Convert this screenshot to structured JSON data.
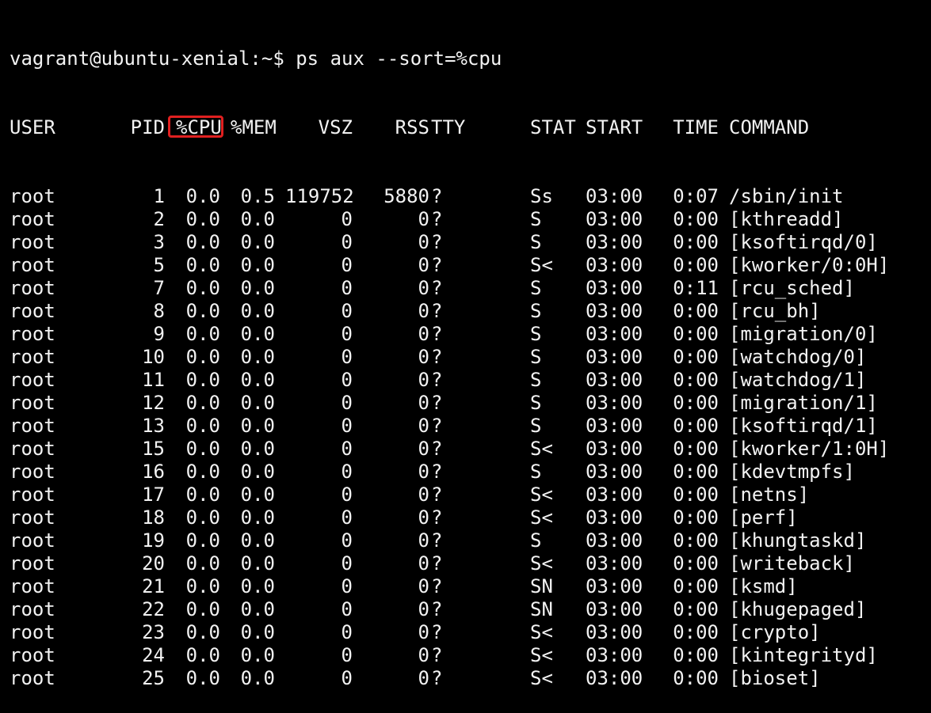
{
  "terminal": {
    "prompt_line": "vagrant@ubuntu-xenial:~$ ps aux --sort=%cpu",
    "highlight_color": "#e02020",
    "header": {
      "user": "USER",
      "pid": "PID",
      "cpu": "%CPU",
      "mem": "%MEM",
      "vsz": "VSZ",
      "rss": "RSS",
      "tty": "TTY",
      "stat": "STAT",
      "start": "START",
      "time": "TIME",
      "command": "COMMAND"
    },
    "rows": [
      {
        "user": "root",
        "pid": "1",
        "cpu": "0.0",
        "mem": "0.5",
        "vsz": "119752",
        "rss": "5880",
        "tty": "?",
        "stat": "Ss",
        "start": "03:00",
        "time": "0:07",
        "command": "/sbin/init"
      },
      {
        "user": "root",
        "pid": "2",
        "cpu": "0.0",
        "mem": "0.0",
        "vsz": "0",
        "rss": "0",
        "tty": "?",
        "stat": "S",
        "start": "03:00",
        "time": "0:00",
        "command": "[kthreadd]"
      },
      {
        "user": "root",
        "pid": "3",
        "cpu": "0.0",
        "mem": "0.0",
        "vsz": "0",
        "rss": "0",
        "tty": "?",
        "stat": "S",
        "start": "03:00",
        "time": "0:00",
        "command": "[ksoftirqd/0]"
      },
      {
        "user": "root",
        "pid": "5",
        "cpu": "0.0",
        "mem": "0.0",
        "vsz": "0",
        "rss": "0",
        "tty": "?",
        "stat": "S<",
        "start": "03:00",
        "time": "0:00",
        "command": "[kworker/0:0H]"
      },
      {
        "user": "root",
        "pid": "7",
        "cpu": "0.0",
        "mem": "0.0",
        "vsz": "0",
        "rss": "0",
        "tty": "?",
        "stat": "S",
        "start": "03:00",
        "time": "0:11",
        "command": "[rcu_sched]"
      },
      {
        "user": "root",
        "pid": "8",
        "cpu": "0.0",
        "mem": "0.0",
        "vsz": "0",
        "rss": "0",
        "tty": "?",
        "stat": "S",
        "start": "03:00",
        "time": "0:00",
        "command": "[rcu_bh]"
      },
      {
        "user": "root",
        "pid": "9",
        "cpu": "0.0",
        "mem": "0.0",
        "vsz": "0",
        "rss": "0",
        "tty": "?",
        "stat": "S",
        "start": "03:00",
        "time": "0:00",
        "command": "[migration/0]"
      },
      {
        "user": "root",
        "pid": "10",
        "cpu": "0.0",
        "mem": "0.0",
        "vsz": "0",
        "rss": "0",
        "tty": "?",
        "stat": "S",
        "start": "03:00",
        "time": "0:00",
        "command": "[watchdog/0]"
      },
      {
        "user": "root",
        "pid": "11",
        "cpu": "0.0",
        "mem": "0.0",
        "vsz": "0",
        "rss": "0",
        "tty": "?",
        "stat": "S",
        "start": "03:00",
        "time": "0:00",
        "command": "[watchdog/1]"
      },
      {
        "user": "root",
        "pid": "12",
        "cpu": "0.0",
        "mem": "0.0",
        "vsz": "0",
        "rss": "0",
        "tty": "?",
        "stat": "S",
        "start": "03:00",
        "time": "0:00",
        "command": "[migration/1]"
      },
      {
        "user": "root",
        "pid": "13",
        "cpu": "0.0",
        "mem": "0.0",
        "vsz": "0",
        "rss": "0",
        "tty": "?",
        "stat": "S",
        "start": "03:00",
        "time": "0:00",
        "command": "[ksoftirqd/1]"
      },
      {
        "user": "root",
        "pid": "15",
        "cpu": "0.0",
        "mem": "0.0",
        "vsz": "0",
        "rss": "0",
        "tty": "?",
        "stat": "S<",
        "start": "03:00",
        "time": "0:00",
        "command": "[kworker/1:0H]"
      },
      {
        "user": "root",
        "pid": "16",
        "cpu": "0.0",
        "mem": "0.0",
        "vsz": "0",
        "rss": "0",
        "tty": "?",
        "stat": "S",
        "start": "03:00",
        "time": "0:00",
        "command": "[kdevtmpfs]"
      },
      {
        "user": "root",
        "pid": "17",
        "cpu": "0.0",
        "mem": "0.0",
        "vsz": "0",
        "rss": "0",
        "tty": "?",
        "stat": "S<",
        "start": "03:00",
        "time": "0:00",
        "command": "[netns]"
      },
      {
        "user": "root",
        "pid": "18",
        "cpu": "0.0",
        "mem": "0.0",
        "vsz": "0",
        "rss": "0",
        "tty": "?",
        "stat": "S<",
        "start": "03:00",
        "time": "0:00",
        "command": "[perf]"
      },
      {
        "user": "root",
        "pid": "19",
        "cpu": "0.0",
        "mem": "0.0",
        "vsz": "0",
        "rss": "0",
        "tty": "?",
        "stat": "S",
        "start": "03:00",
        "time": "0:00",
        "command": "[khungtaskd]"
      },
      {
        "user": "root",
        "pid": "20",
        "cpu": "0.0",
        "mem": "0.0",
        "vsz": "0",
        "rss": "0",
        "tty": "?",
        "stat": "S<",
        "start": "03:00",
        "time": "0:00",
        "command": "[writeback]"
      },
      {
        "user": "root",
        "pid": "21",
        "cpu": "0.0",
        "mem": "0.0",
        "vsz": "0",
        "rss": "0",
        "tty": "?",
        "stat": "SN",
        "start": "03:00",
        "time": "0:00",
        "command": "[ksmd]"
      },
      {
        "user": "root",
        "pid": "22",
        "cpu": "0.0",
        "mem": "0.0",
        "vsz": "0",
        "rss": "0",
        "tty": "?",
        "stat": "SN",
        "start": "03:00",
        "time": "0:00",
        "command": "[khugepaged]"
      },
      {
        "user": "root",
        "pid": "23",
        "cpu": "0.0",
        "mem": "0.0",
        "vsz": "0",
        "rss": "0",
        "tty": "?",
        "stat": "S<",
        "start": "03:00",
        "time": "0:00",
        "command": "[crypto]"
      },
      {
        "user": "root",
        "pid": "24",
        "cpu": "0.0",
        "mem": "0.0",
        "vsz": "0",
        "rss": "0",
        "tty": "?",
        "stat": "S<",
        "start": "03:00",
        "time": "0:00",
        "command": "[kintegrityd]"
      },
      {
        "user": "root",
        "pid": "25",
        "cpu": "0.0",
        "mem": "0.0",
        "vsz": "0",
        "rss": "0",
        "tty": "?",
        "stat": "S<",
        "start": "03:00",
        "time": "0:00",
        "command": "[bioset]"
      }
    ]
  }
}
